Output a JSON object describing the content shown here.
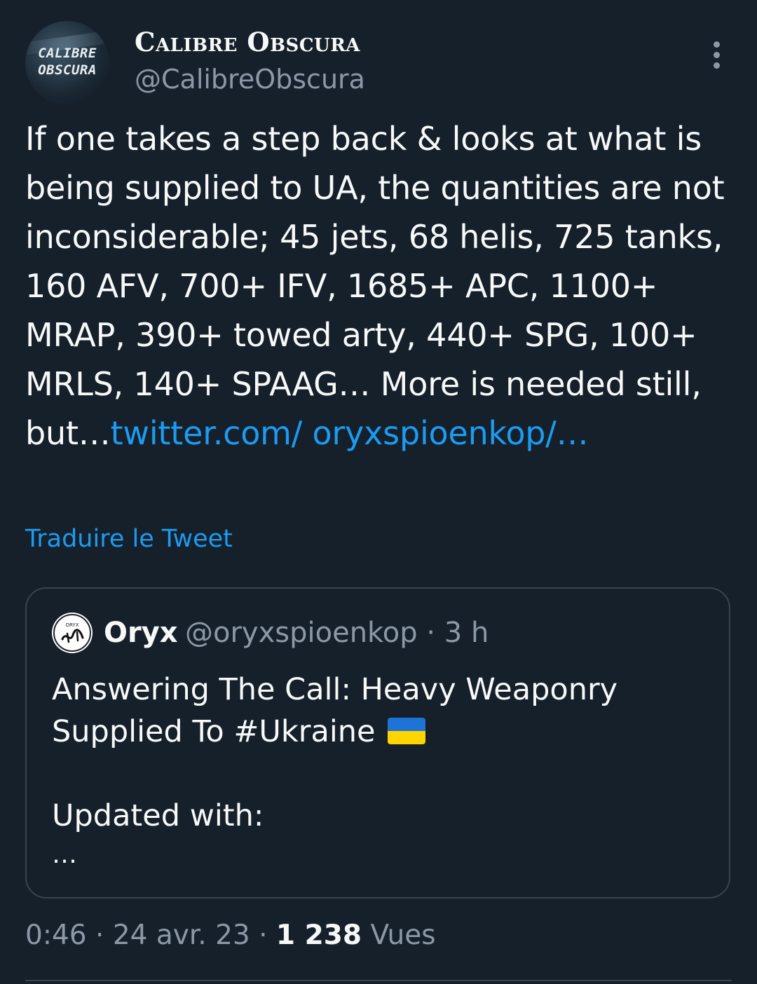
{
  "author": {
    "avatar_text_line1": "CALIBRE",
    "avatar_text_line2": "OBSCURA",
    "display_name": "Calibre Obscura",
    "handle": "@CalibreObscura"
  },
  "tweet": {
    "text": "If one takes a step back & looks at what is being supplied to UA, the quantities are not inconsiderable; 45 jets, 68 helis, 725 tanks, 160 AFV, 700+ IFV, 1685+ APC, 1100+ MRAP, 390+ towed arty, 440+ SPG, 100+ MRLS, 140+ SPAAG… More is needed still, but…",
    "link_text": "twitter.com/ oryxspioenkop/…",
    "translate_label": "Traduire le Tweet"
  },
  "quote": {
    "display_name": "Oryx",
    "handle": "@oryxspioenkop",
    "separator": "·",
    "time": "3 h",
    "avatar_text": "ORYX",
    "text_line1": "Answering The Call: Heavy Weaponry Supplied To #Ukraine",
    "flag_icon": "ukraine-flag-icon",
    "text_line2": "Updated with:",
    "ellipsis": "…"
  },
  "meta": {
    "time": "0:46",
    "separator": "·",
    "date": "24 avr. 23",
    "views_count": "1 238",
    "views_label": "Vues"
  },
  "colors": {
    "background": "#15202b",
    "primary_text": "#f7f9f9",
    "secondary_text": "#8b98a5",
    "link": "#1d9bf0",
    "border": "#38444d"
  }
}
